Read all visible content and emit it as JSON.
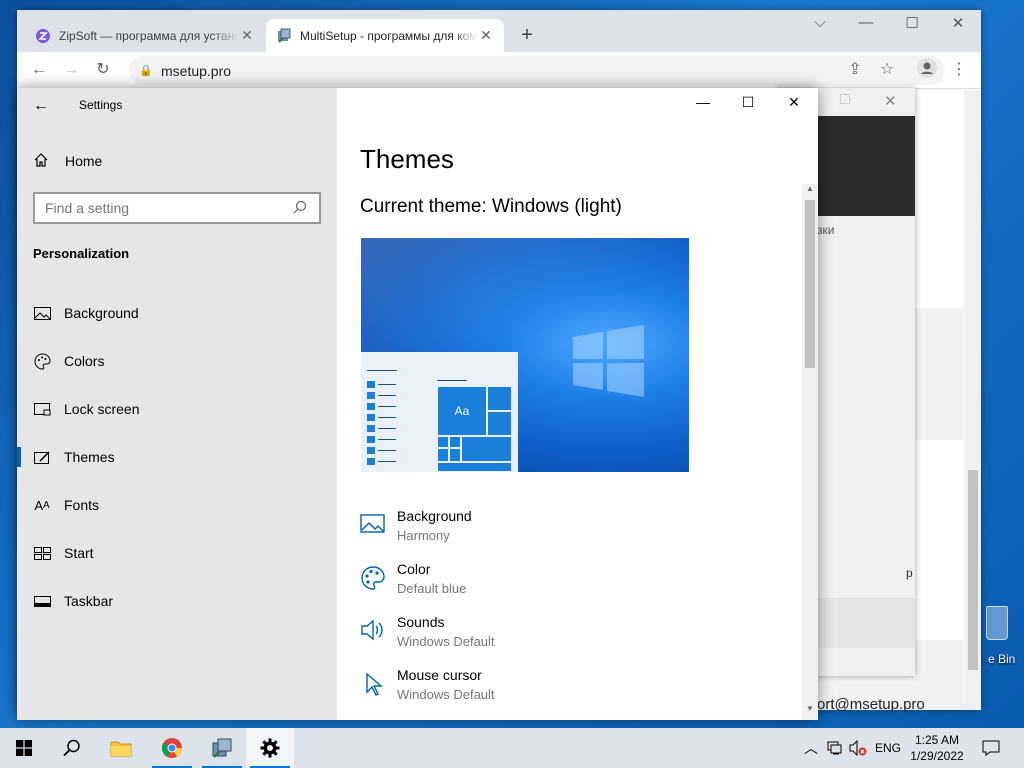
{
  "browser": {
    "tabs": [
      {
        "title": "ZipSoft — программа для установки",
        "active": false
      },
      {
        "title": "MultiSetup - программы для компьютера",
        "active": true
      }
    ],
    "url": "msetup.pro",
    "page": {
      "partial_text_1": "узки",
      "partial_text_2": "p",
      "email": "ort@msetup.pro"
    }
  },
  "settings": {
    "app_title": "Settings",
    "home_label": "Home",
    "search_placeholder": "Find a setting",
    "section_title": "Personalization",
    "nav_items": [
      {
        "label": "Background",
        "icon": "picture-icon"
      },
      {
        "label": "Colors",
        "icon": "palette-icon"
      },
      {
        "label": "Lock screen",
        "icon": "lock-screen-icon"
      },
      {
        "label": "Themes",
        "icon": "themes-icon",
        "selected": true
      },
      {
        "label": "Fonts",
        "icon": "fonts-icon"
      },
      {
        "label": "Start",
        "icon": "start-icon"
      },
      {
        "label": "Taskbar",
        "icon": "taskbar-icon"
      }
    ],
    "page_title": "Themes",
    "current_theme": "Current theme: Windows (light)",
    "preview_tile_text": "Aa",
    "theme_parts": [
      {
        "title": "Background",
        "value": "Harmony",
        "icon": "picture-icon"
      },
      {
        "title": "Color",
        "value": "Default blue",
        "icon": "palette-icon"
      },
      {
        "title": "Sounds",
        "value": "Windows Default",
        "icon": "speaker-icon"
      },
      {
        "title": "Mouse cursor",
        "value": "Windows Default",
        "icon": "cursor-icon"
      }
    ],
    "accent_color": "#0063b1"
  },
  "desktop": {
    "recycle_bin_label": "e Bin"
  },
  "taskbar": {
    "language": "ENG",
    "time": "1:25 AM",
    "date": "1/29/2022"
  }
}
